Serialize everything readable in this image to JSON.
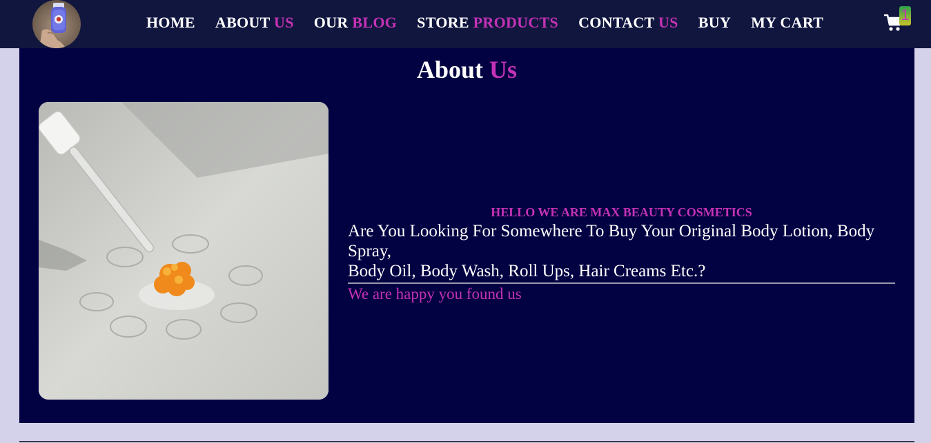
{
  "nav": {
    "items": [
      {
        "label": "HOME",
        "accent": ""
      },
      {
        "label": "ABOUT",
        "accent": "US"
      },
      {
        "label": "OUR",
        "accent": "BLOG"
      },
      {
        "label": "STORE",
        "accent": "PRODUCTS"
      },
      {
        "label": "CONTACT",
        "accent": "US"
      },
      {
        "label": "BUY",
        "accent": ""
      },
      {
        "label": "MY CART",
        "accent": ""
      }
    ],
    "cart_icon": "shopping-cart-icon",
    "cart_count": "1"
  },
  "about": {
    "title_main": "About",
    "title_accent": "Us",
    "hello": "HELLO WE ARE MAX BEAUTY COSMETICS",
    "headline_line1": "Are You Looking For Somewhere To Buy Your Original Body Lotion, Body Spray,",
    "headline_line2": "Body Oil, Body Wash, Roll Ups, Hair Creams Etc.?",
    "found": "We are happy you found us"
  },
  "colors": {
    "navbar": "#11163f",
    "section": "#020142",
    "accent": "#c532b6",
    "page": "#d4d2ea"
  }
}
